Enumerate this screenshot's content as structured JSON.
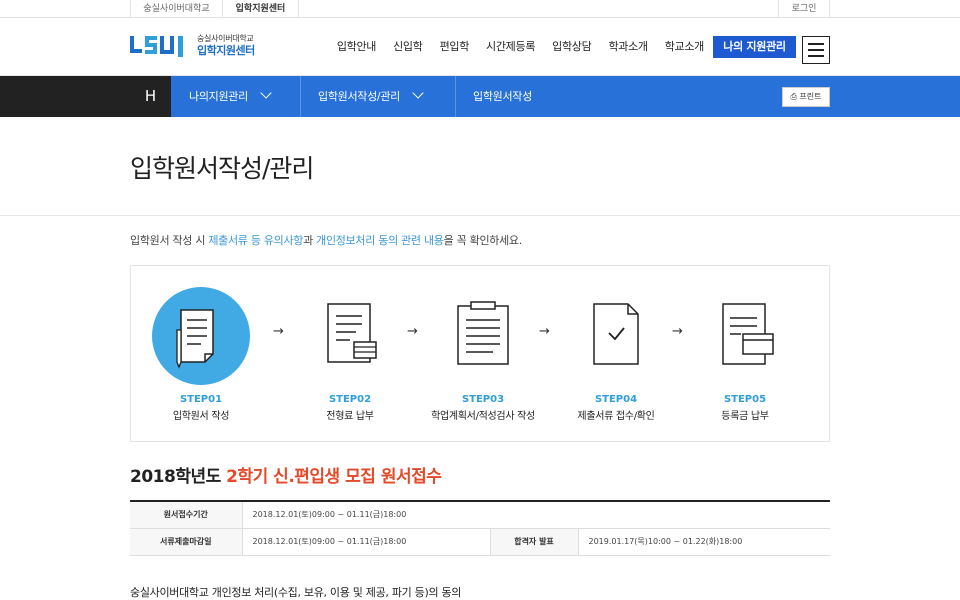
{
  "utility": {
    "school": "숭실사이버대학교",
    "center": "입학지원센터",
    "login": "로그인"
  },
  "logo": {
    "line1": "숭실사이버대학교",
    "line2": "입학지원센터"
  },
  "gnb": [
    "입학안내",
    "신입학",
    "편입학",
    "시간제등록",
    "입학상담",
    "학과소개",
    "학교소개"
  ],
  "my_button": "나의 지원관리",
  "breadcrumb": {
    "home": "H",
    "level1": "나의지원관리",
    "level2": "입학원서작성/관리",
    "level3": "입학원서작성"
  },
  "print_label": "프린트",
  "page_title": "입학원서작성/관리",
  "notice": {
    "pre": "입학원서 작성 시 ",
    "link1": "제출서류 등 유의사항",
    "mid": "과 ",
    "link2": "개인정보처리 동의 관련 내용",
    "post": "을 꼭 확인하세요."
  },
  "steps": [
    {
      "code": "STEP01",
      "label": "입학원서 작성",
      "icon": "document-pen-icon"
    },
    {
      "code": "STEP02",
      "label": "전형료 납부",
      "icon": "document-money-icon"
    },
    {
      "code": "STEP03",
      "label": "학업계획서/적성검사 작성",
      "icon": "clipboard-icon"
    },
    {
      "code": "STEP04",
      "label": "제출서류 접수/확인",
      "icon": "document-check-icon"
    },
    {
      "code": "STEP05",
      "label": "등록금 납부",
      "icon": "document-card-icon"
    }
  ],
  "recruit": {
    "title_pre": "2018학년도 ",
    "title_hl": "2학기 신.편입생 모집 원서접수",
    "rows": [
      {
        "label": "원서접수기간",
        "value": "2018.12.01(토)09:00 ~ 01.11(금)18:00"
      },
      {
        "label": "서류제출마감일",
        "value": "2018.12.01(토)09:00 ~ 01.11(금)18:00",
        "label2": "합격자 발표",
        "value2": "2019.01.17(목)10:00 ~ 01.22(화)18:00"
      }
    ]
  },
  "privacy_title": "숭실사이버대학교 개인정보 처리(수집, 보유, 이용 및 제공, 파기 등)의 동의",
  "colors": {
    "primary": "#2771d8",
    "button": "#1d59d1",
    "accent": "#2e9fd8",
    "highlight": "#e34a2a"
  }
}
